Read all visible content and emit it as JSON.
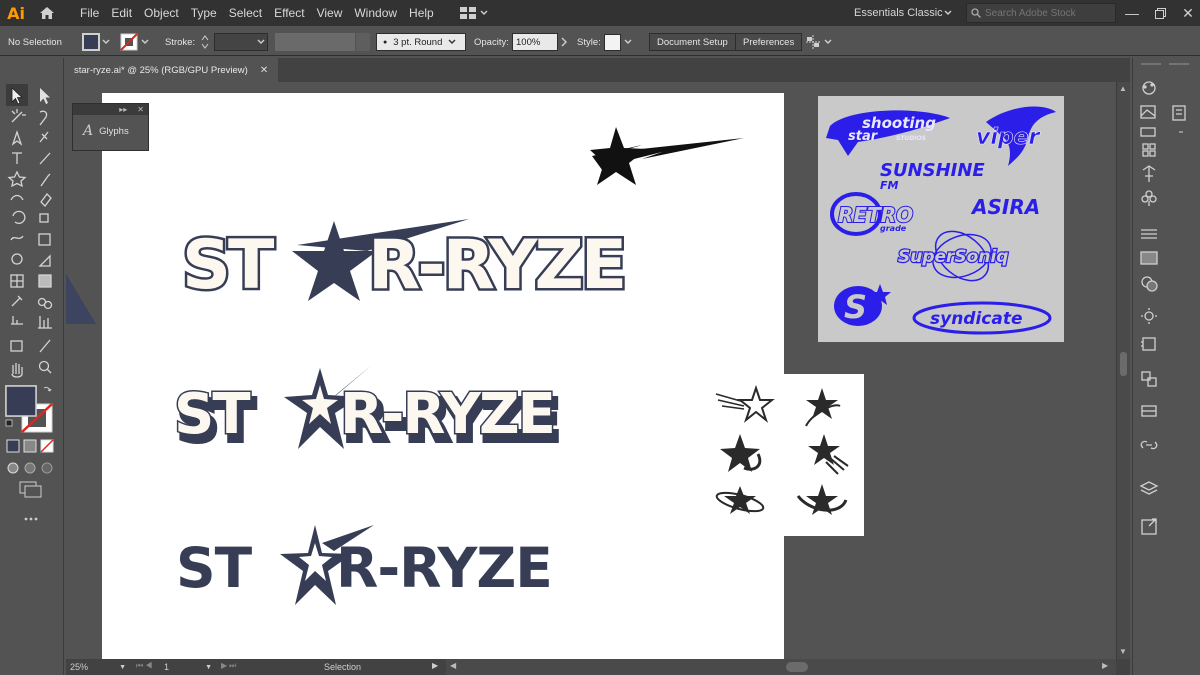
{
  "app": {
    "logo": "Ai",
    "workspace": "Essentials Classic"
  },
  "menu": [
    "File",
    "Edit",
    "Object",
    "Type",
    "Select",
    "Effect",
    "View",
    "Window",
    "Help"
  ],
  "search": {
    "placeholder": "Search Adobe Stock"
  },
  "control": {
    "selection": "No Selection",
    "stroke_label": "Stroke:",
    "brush": "3 pt. Round",
    "opacity_label": "Opacity:",
    "opacity_value": "100%",
    "style_label": "Style:",
    "document_setup": "Document Setup",
    "preferences": "Preferences"
  },
  "document": {
    "tab_title": "star-ryze.ai* @ 25% (RGB/GPU Preview)"
  },
  "glyphs_panel": {
    "title": "Glyphs"
  },
  "artwork": {
    "logo_text_left": "ST",
    "logo_text_right": "R-RYZE",
    "logo_fill": "#fdf8ef",
    "logo_dark": "#363d55"
  },
  "reference": {
    "logos": [
      "shooting",
      "star",
      "STUDIOS",
      "viper",
      "SUNSHINE",
      "FM",
      "RETRO",
      "grade",
      "ASIRA",
      "SuperSoniq",
      "S",
      "syndicate"
    ],
    "color": "#2a1ee8"
  },
  "status": {
    "zoom": "25%",
    "page": "1",
    "mode": "Selection"
  }
}
